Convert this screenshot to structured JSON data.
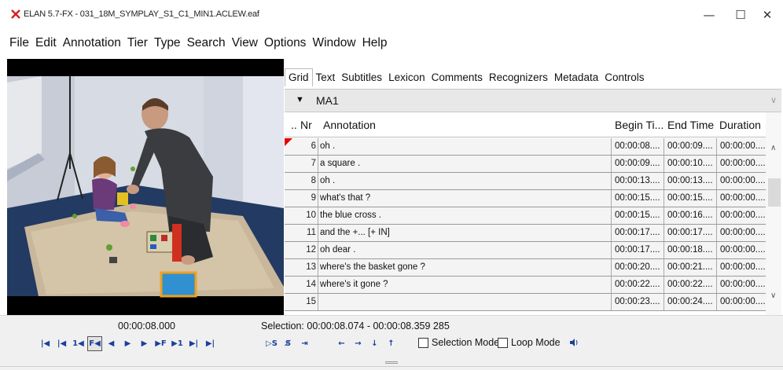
{
  "window": {
    "title": "ELAN 5.7-FX - 031_18M_SYMPLAY_S1_C1_MIN1.ACLEW.eaf",
    "app_icon": "elan-x-icon",
    "controls": [
      "minimize-icon",
      "maximize-icon",
      "close-icon"
    ],
    "minimize_glyph": "—",
    "maximize_glyph": "☐",
    "close_glyph": "✕"
  },
  "menu": [
    "File",
    "Edit",
    "Annotation",
    "Tier",
    "Type",
    "Search",
    "View",
    "Options",
    "Window",
    "Help"
  ],
  "tabs": [
    {
      "label": "Grid",
      "active": true
    },
    {
      "label": "Text"
    },
    {
      "label": "Subtitles"
    },
    {
      "label": "Lexicon"
    },
    {
      "label": "Comments"
    },
    {
      "label": "Recognizers"
    },
    {
      "label": "Metadata"
    },
    {
      "label": "Controls"
    }
  ],
  "tier": {
    "arrow": "▼",
    "name": "MA1",
    "chevron": "∨"
  },
  "grid": {
    "headers": {
      "marker": "..",
      "nr": "Nr",
      "annotation": "Annotation",
      "begin": "Begin Ti...",
      "end": "End Time",
      "duration": "Duration"
    },
    "rows": [
      {
        "nr": "6",
        "annotation": "oh .",
        "begin": "00:00:08....",
        "end": "00:00:09....",
        "duration": "00:00:00....",
        "current": true
      },
      {
        "nr": "7",
        "annotation": "a square .",
        "begin": "00:00:09....",
        "end": "00:00:10....",
        "duration": "00:00:00...."
      },
      {
        "nr": "8",
        "annotation": "oh .",
        "begin": "00:00:13....",
        "end": "00:00:13....",
        "duration": "00:00:00...."
      },
      {
        "nr": "9",
        "annotation": "what's that ?",
        "begin": "00:00:15....",
        "end": "00:00:15....",
        "duration": "00:00:00...."
      },
      {
        "nr": "10",
        "annotation": "the blue cross .",
        "begin": "00:00:15....",
        "end": "00:00:16....",
        "duration": "00:00:00...."
      },
      {
        "nr": "11",
        "annotation": "and the +... [+ IN]",
        "begin": "00:00:17....",
        "end": "00:00:17....",
        "duration": "00:00:00...."
      },
      {
        "nr": "12",
        "annotation": "oh dear .",
        "begin": "00:00:17....",
        "end": "00:00:18....",
        "duration": "00:00:00...."
      },
      {
        "nr": "13",
        "annotation": "where's the basket gone ?",
        "begin": "00:00:20....",
        "end": "00:00:21....",
        "duration": "00:00:00...."
      },
      {
        "nr": "14",
        "annotation": "where's it gone ?",
        "begin": "00:00:22....",
        "end": "00:00:22....",
        "duration": "00:00:00...."
      },
      {
        "nr": "15",
        "annotation": "",
        "begin": "00:00:23....",
        "end": "00:00:24....",
        "duration": "00:00:00...."
      }
    ],
    "scroll_up": "∧",
    "scroll_down": "∨"
  },
  "media": {
    "current_time": "00:00:08.000",
    "selection": "Selection: 00:00:08.074 - 00:00:08.359  285"
  },
  "player_buttons": [
    {
      "icon": "go-to-begin-icon",
      "glyph": "|◀"
    },
    {
      "icon": "previous-scrollview-icon",
      "glyph": "|◀"
    },
    {
      "icon": "previous-second-icon",
      "glyph": "1◀"
    },
    {
      "icon": "previous-frame-icon",
      "glyph": "F◀",
      "framed": true
    },
    {
      "icon": "previous-pixel-icon",
      "glyph": "◀"
    },
    {
      "icon": "play-icon",
      "glyph": "▶"
    },
    {
      "icon": "next-pixel-icon",
      "glyph": "▶"
    },
    {
      "icon": "next-frame-icon",
      "glyph": "▶F"
    },
    {
      "icon": "next-second-icon",
      "glyph": "▶1"
    },
    {
      "icon": "next-scrollview-icon",
      "glyph": "▶|"
    },
    {
      "icon": "go-to-end-icon",
      "glyph": "▶|"
    }
  ],
  "selection_buttons": [
    {
      "icon": "play-selection-icon",
      "glyph": "▷S"
    },
    {
      "icon": "clear-selection-icon",
      "glyph": "S̸"
    },
    {
      "icon": "selection-to-begin-icon",
      "glyph": "⇥"
    }
  ],
  "nav_buttons": [
    {
      "icon": "arrow-left-icon",
      "glyph": "←"
    },
    {
      "icon": "arrow-right-icon",
      "glyph": "→"
    },
    {
      "icon": "arrow-down-icon",
      "glyph": "↓"
    },
    {
      "icon": "arrow-up-icon",
      "glyph": "↑"
    }
  ],
  "options": {
    "selection_mode": "Selection Mode",
    "loop_mode": "Loop Mode"
  },
  "volume_icon": "speaker-icon",
  "colors": {
    "accent": "#1d3f9c",
    "grid_row": "#f4f4f4",
    "tier_bar": "#e8e8e8",
    "current_marker": "#e00000"
  }
}
